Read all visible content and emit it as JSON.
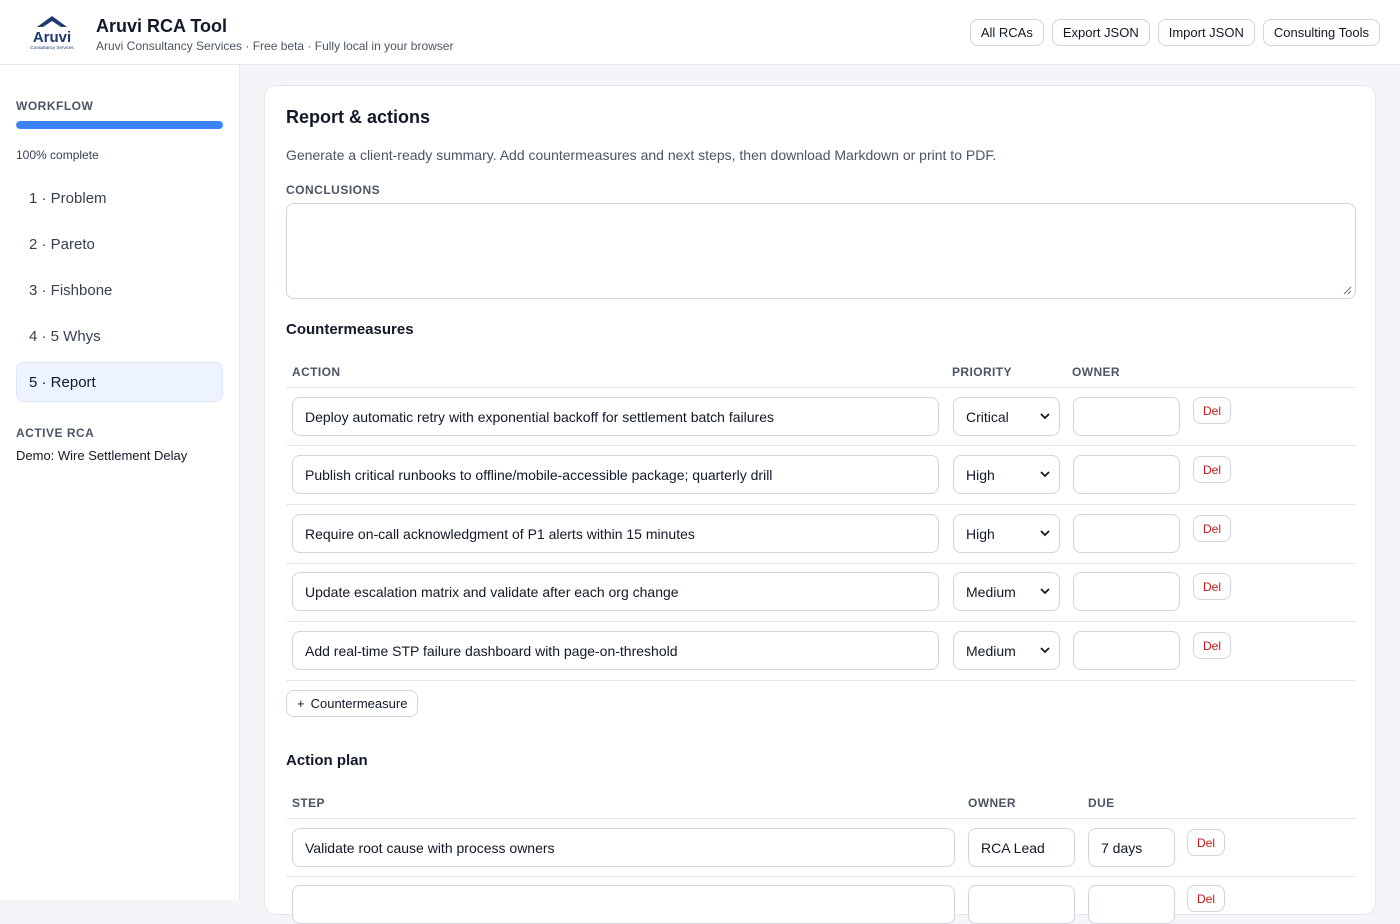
{
  "app": {
    "title": "Aruvi RCA Tool",
    "subtitle": "Aruvi Consultancy Services · Free beta · Fully local in your browser",
    "logo_text": "Aruvi",
    "logo_subtext": "Consultancy Services",
    "brand_color": "#1e3a6e"
  },
  "header_actions": [
    {
      "label": "All RCAs"
    },
    {
      "label": "Export JSON"
    },
    {
      "label": "Import JSON"
    },
    {
      "label": "Consulting Tools"
    }
  ],
  "sidebar": {
    "workflow_label": "WORKFLOW",
    "progress_fraction": 1.0,
    "progress_text": "100% complete",
    "steps": [
      {
        "label": "1 · Problem"
      },
      {
        "label": "2 · Pareto"
      },
      {
        "label": "3 · Fishbone"
      },
      {
        "label": "4 · 5 Whys"
      },
      {
        "label": "5 · Report",
        "active": true
      }
    ],
    "active_rca_label": "ACTIVE RCA",
    "active_rca_name": "Demo: Wire Settlement Delay"
  },
  "report": {
    "title": "Report & actions",
    "description": "Generate a client-ready summary. Add countermeasures and next steps, then download Markdown or print to PDF.",
    "conclusions_label": "CONCLUSIONS",
    "conclusions_value": ""
  },
  "countermeasures": {
    "title": "Countermeasures",
    "headers": {
      "action": "ACTION",
      "priority": "PRIORITY",
      "owner": "OWNER"
    },
    "rows": [
      {
        "action": "Deploy automatic retry with exponential backoff for settlement batch failures",
        "priority": "Critical",
        "owner": ""
      },
      {
        "action": "Publish critical runbooks to offline/mobile-accessible package; quarterly drill",
        "priority": "High",
        "owner": ""
      },
      {
        "action": "Require on-call acknowledgment of P1 alerts within 15 minutes",
        "priority": "High",
        "owner": ""
      },
      {
        "action": "Update escalation matrix and validate after each org change",
        "priority": "Medium",
        "owner": ""
      },
      {
        "action": "Add real-time STP failure dashboard with page-on-threshold",
        "priority": "Medium",
        "owner": ""
      }
    ],
    "delete_label": "Del",
    "add_label": "Countermeasure",
    "add_icon": "+"
  },
  "action_plan": {
    "title": "Action plan",
    "headers": {
      "step": "STEP",
      "owner": "OWNER",
      "due": "DUE"
    },
    "rows": [
      {
        "step": "Validate root cause with process owners",
        "owner": "RCA Lead",
        "due": "7 days"
      },
      {
        "step": "",
        "owner": "",
        "due": ""
      }
    ],
    "delete_label": "Del"
  }
}
